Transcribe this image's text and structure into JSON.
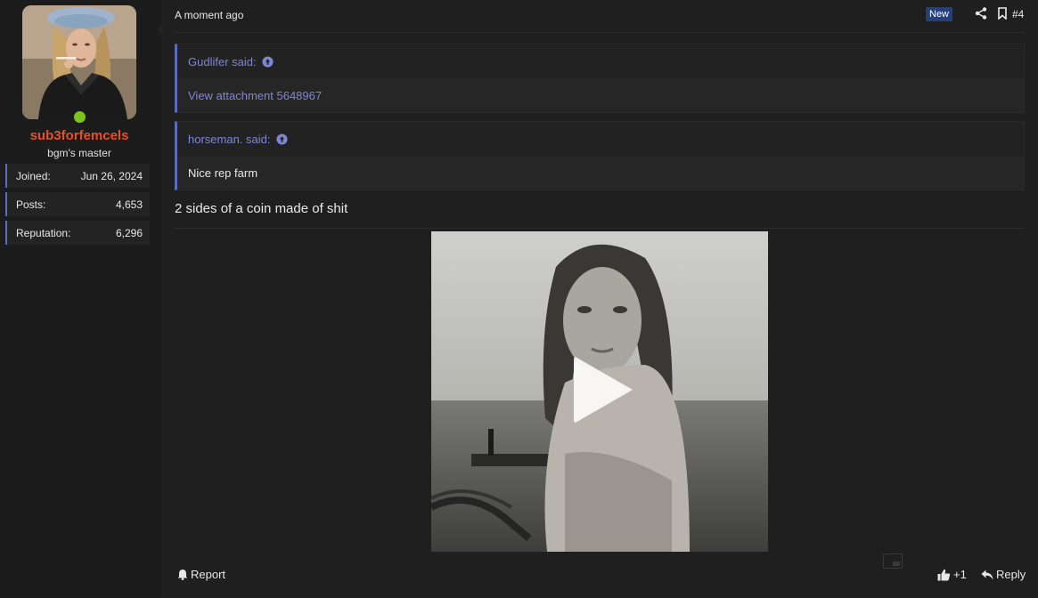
{
  "user": {
    "username": "sub3forfemcels",
    "title": "bgm's master",
    "online": true,
    "stats": [
      {
        "label": "Joined:",
        "value": "Jun 26, 2024"
      },
      {
        "label": "Posts:",
        "value": "4,653"
      },
      {
        "label": "Reputation:",
        "value": "6,296"
      }
    ]
  },
  "post": {
    "timestamp": "A moment ago",
    "badge": "New",
    "number": "#4",
    "quotes": [
      {
        "author": "Gudlifer said:",
        "body": "View attachment 5648967",
        "body_is_link": true
      },
      {
        "author": "horseman. said:",
        "body": "Nice rep farm",
        "body_is_link": false
      }
    ],
    "text": "2 sides of a coin made of shit",
    "footer": {
      "report_label": "Report",
      "like_label": "+1",
      "reply_label": "Reply"
    }
  },
  "colors": {
    "username": "#e5502a",
    "accent": "#5d6bbf",
    "quote_link": "#7d87d8",
    "online": "#7ac41b",
    "badge_bg": "#27407a"
  },
  "icons": {
    "share": "share-icon",
    "bookmark": "bookmark-icon",
    "up_arrow": "arrow-up-circle-icon",
    "report": "bell-icon",
    "like": "thumbs-up-icon",
    "reply": "reply-icon",
    "play": "play-icon",
    "pip": "picture-in-picture-icon"
  }
}
